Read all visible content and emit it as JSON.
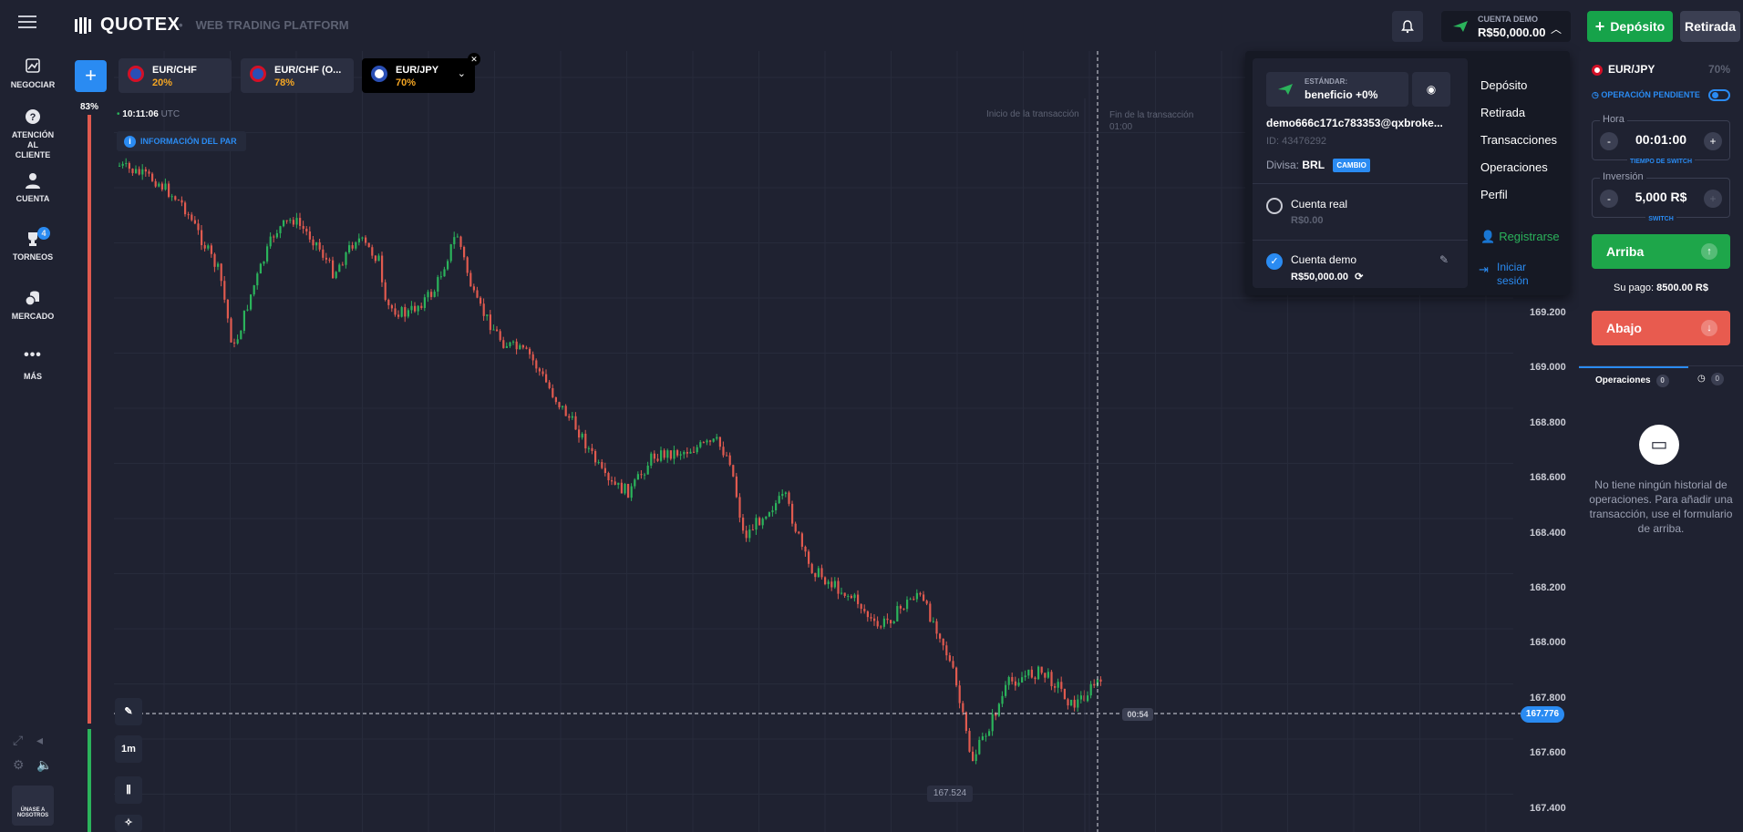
{
  "header": {
    "logo": "QUOTEX",
    "subtitle": "WEB TRADING PLATFORM",
    "account_label": "CUENTA DEMO",
    "account_balance": "R$50,000.00",
    "deposit_label": "Depósito",
    "withdraw_label": "Retirada"
  },
  "sidebar": {
    "items": [
      {
        "label": "NEGOCIAR",
        "icon": "chart-icon"
      },
      {
        "label": "ATENCIÓN AL CLIENTE",
        "icon": "help-icon"
      },
      {
        "label": "CUENTA",
        "icon": "user-icon"
      },
      {
        "label": "TORNEOS",
        "icon": "trophy-icon",
        "badge": "4"
      },
      {
        "label": "MERCADO",
        "icon": "coins-icon"
      },
      {
        "label": "MÁS",
        "icon": "more-icon"
      }
    ],
    "join_label": "ÚNASE A NOSOTROS"
  },
  "tabs": [
    {
      "name": "EUR/CHF",
      "pct": "20%"
    },
    {
      "name": "EUR/CHF (O...",
      "pct": "78%"
    },
    {
      "name": "EUR/JPY",
      "pct": "70%"
    }
  ],
  "chart": {
    "sentiment_pct": "83%",
    "time": "10:11:06",
    "tz": "UTC",
    "pair_info": "INFORMACIÓN DEL PAR",
    "timeframe": "1m",
    "trans_start": "Inicio de la transacción",
    "trans_end": "Fin de la transacción",
    "trans_end_time": "01:00",
    "current_price": "167.776",
    "timer": "00:54",
    "low_price": "167.524",
    "price_labels": [
      "169.200",
      "169.000",
      "168.800",
      "168.600",
      "168.400",
      "168.200",
      "168.000",
      "167.800",
      "167.600",
      "167.400"
    ]
  },
  "dropdown": {
    "standard_label": "ESTÁNDAR:",
    "standard_value": "beneficio +0%",
    "email": "demo666c171c783353@qxbroke...",
    "id": "ID: 43476292",
    "currency_label": "Divisa:",
    "currency": "BRL",
    "change_label": "CAMBIO",
    "real_account": "Cuenta real",
    "real_balance": "R$0.00",
    "demo_account": "Cuenta demo",
    "demo_balance": "R$50,000.00",
    "menu": [
      "Depósito",
      "Retirada",
      "Transacciones",
      "Operaciones",
      "Perfil"
    ],
    "register": "Registrarse",
    "login": "Iniciar sesión"
  },
  "trade_panel": {
    "asset": "EUR/JPY",
    "payout_pct": "70%",
    "pending_label": "OPERACIÓN PENDIENTE",
    "time_label": "Hora",
    "time_value": "00:01:00",
    "time_switch": "TIEMPO DE SWITCH",
    "investment_label": "Inversión",
    "investment_value": "5,000 R$",
    "investment_switch": "SWITCH",
    "up_label": "Arriba",
    "payout_text": "Su pago:",
    "payout_value": "8500.00 R$",
    "down_label": "Abajo",
    "ops_tab": "Operaciones",
    "ops_count": "0",
    "history_count": "0",
    "empty_text": "No tiene ningún historial de operaciones. Para añadir una transacción, use el formulario de arriba."
  }
}
